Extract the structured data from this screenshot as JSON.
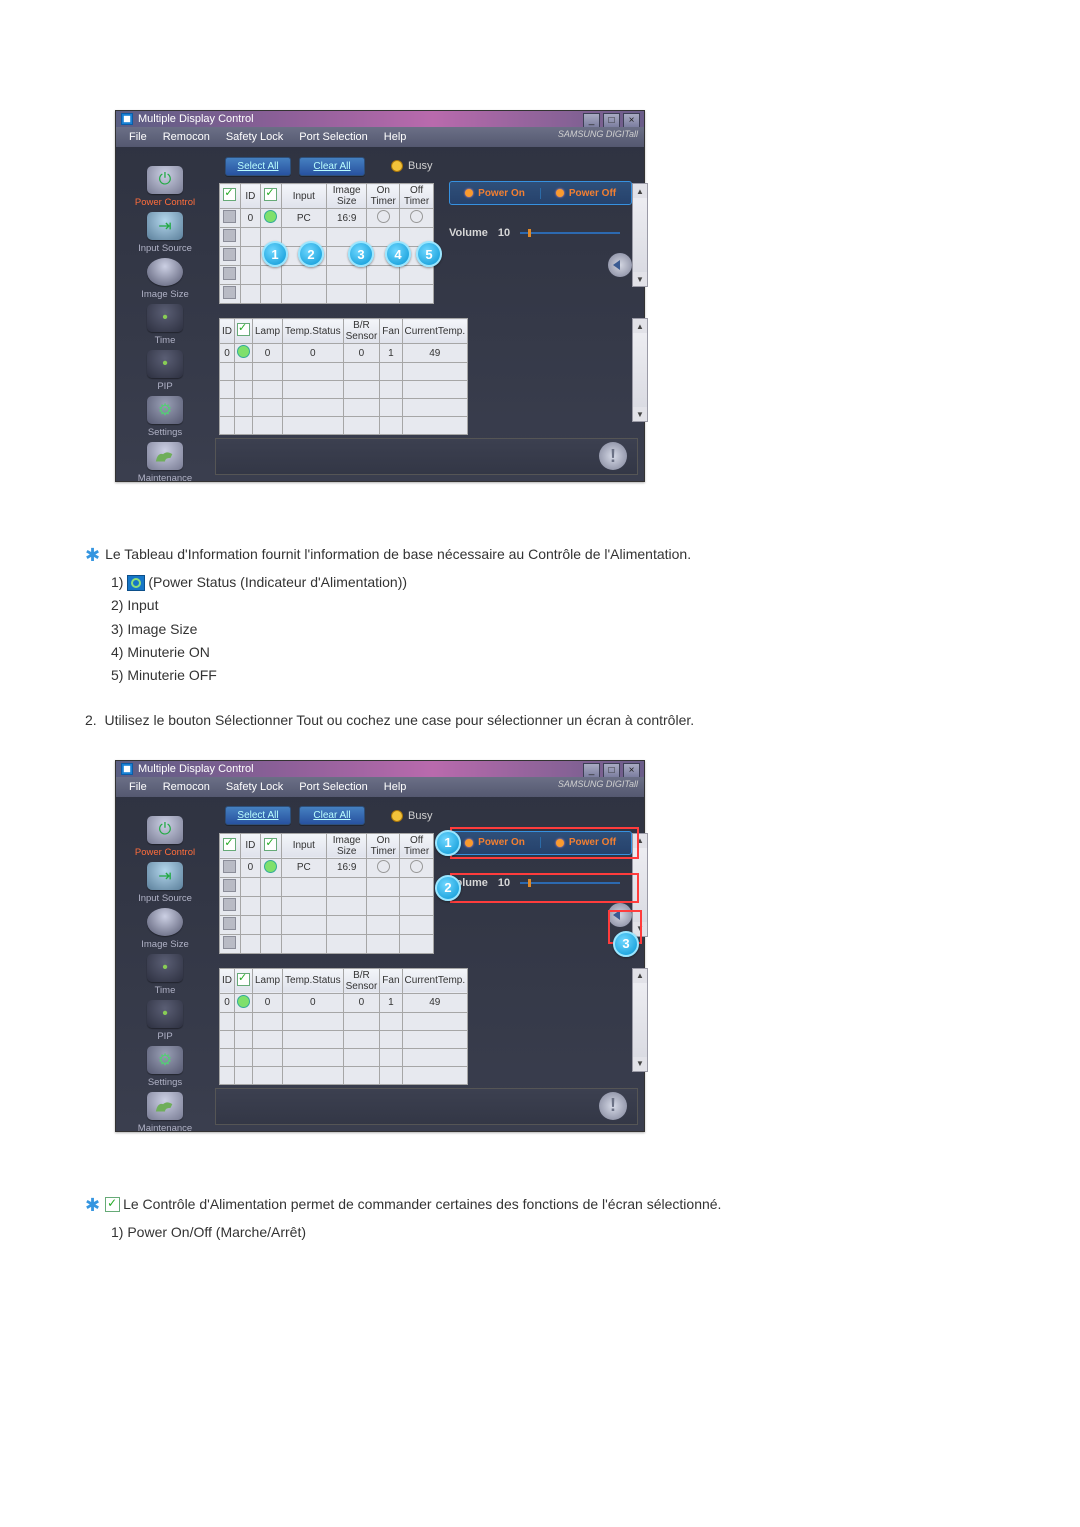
{
  "app": {
    "title": "Multiple Display Control",
    "brand": "SAMSUNG DIGITall"
  },
  "menu": [
    "File",
    "Remocon",
    "Safety Lock",
    "Port Selection",
    "Help"
  ],
  "sidebar": [
    {
      "label": "Power Control",
      "active": true
    },
    {
      "label": "Input Source"
    },
    {
      "label": "Image Size"
    },
    {
      "label": "Time"
    },
    {
      "label": "PIP"
    },
    {
      "label": "Settings"
    },
    {
      "label": "Maintenance"
    }
  ],
  "toolbar": {
    "select_all": "Select All",
    "clear_all": "Clear All",
    "busy": "Busy"
  },
  "table1": {
    "headers": [
      "",
      "ID",
      "",
      "Input",
      "Image Size",
      "On Timer",
      "Off Timer"
    ],
    "row": {
      "id": "0",
      "input": "PC",
      "image_size": "16:9"
    }
  },
  "table2": {
    "headers": [
      "ID",
      "",
      "Lamp",
      "Temp.Status",
      "B/R Sensor",
      "Fan",
      "CurrentTemp."
    ],
    "row": {
      "id": "0",
      "lamp": "0",
      "temp_status": "0",
      "br": "0",
      "fan": "1",
      "curtemp": "49"
    }
  },
  "right_panel": {
    "power_on": "Power On",
    "power_off": "Power Off",
    "volume_label": "Volume",
    "volume_value": "10"
  },
  "bubbles1": [
    "1",
    "2",
    "3",
    "4",
    "5"
  ],
  "bubbles2": [
    "1",
    "2",
    "3"
  ],
  "doc": {
    "para1": "Le Tableau d'Information fournit l'information de base nécessaire au Contrôle de l'Alimentation.",
    "list1": [
      "(Power Status (Indicateur d'Alimentation))",
      "Input",
      "Image Size",
      "Minuterie ON",
      "Minuterie OFF"
    ],
    "para2_num": "2.",
    "para2": "Utilisez le bouton Sélectionner Tout ou cochez une case pour sélectionner un écran à contrôler.",
    "para3": "Le Contrôle d'Alimentation permet de commander certaines des fonctions de l'écran sélectionné.",
    "list2_item": "Power On/Off (Marche/Arrêt)"
  }
}
